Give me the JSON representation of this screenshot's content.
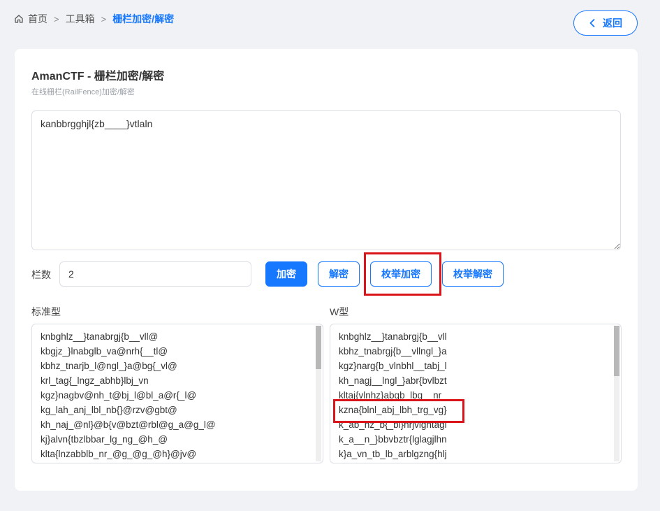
{
  "breadcrumb": {
    "home": "首页",
    "toolbox": "工具箱",
    "current": "栅栏加密/解密"
  },
  "back_button": "返回",
  "card": {
    "title": "AmanCTF - 栅栏加密/解密",
    "subtitle": "在线栅栏(RailFence)加密/解密"
  },
  "input": {
    "value": "kanbbrgghjl{zb____}vtlaln"
  },
  "rails": {
    "label": "栏数",
    "value": "2"
  },
  "buttons": {
    "encrypt": "加密",
    "decrypt": "解密",
    "enum_encrypt": "枚举加密",
    "enum_decrypt": "枚举解密"
  },
  "standard": {
    "label": "标准型",
    "lines": [
      "knbghlz__}tanabrgj{b__vll@",
      "kbgjz_}lnabglb_va@nrh{__tl@",
      "kbhz_tnarjb_l@ngl_}a@bg{_vl@",
      "krl_tag{_lngz_abhb}lbj_vn",
      "kgz}nagbv@nh_t@bj_l@bl_a@r{_l@",
      "kg_lah_anj_lbl_nb{}@rzv@gbt@",
      "kh_naj_@nl}@b{v@bzt@rbl@g_a@g_l@",
      "kj}alvn{tbzlbbar_lg_ng_@h_@",
      "klta{lnzabblb_nr_@g_@g_@h}@jv@"
    ]
  },
  "wtype": {
    "label": "W型",
    "lines": [
      "knbghlz__}tanabrgj{b__vll",
      "kbhz_tnabrgj{b__vllngl_}a",
      "kgz}narg{b_vlnbhl__tabj_l",
      "kh_nagj__lngl_}abr{bvlbzt",
      "kltaj{vlnhz}abgb_lbg__nr",
      "kzna{blnl_abj_lbh_trg_vg}",
      "k_ab_hz_b{_bl}nrjvlgntagl",
      "k_a__n_}bbvbztr{lglagjlhn",
      "k}a_vn_tb_lb_arblgzng{hlj"
    ]
  }
}
